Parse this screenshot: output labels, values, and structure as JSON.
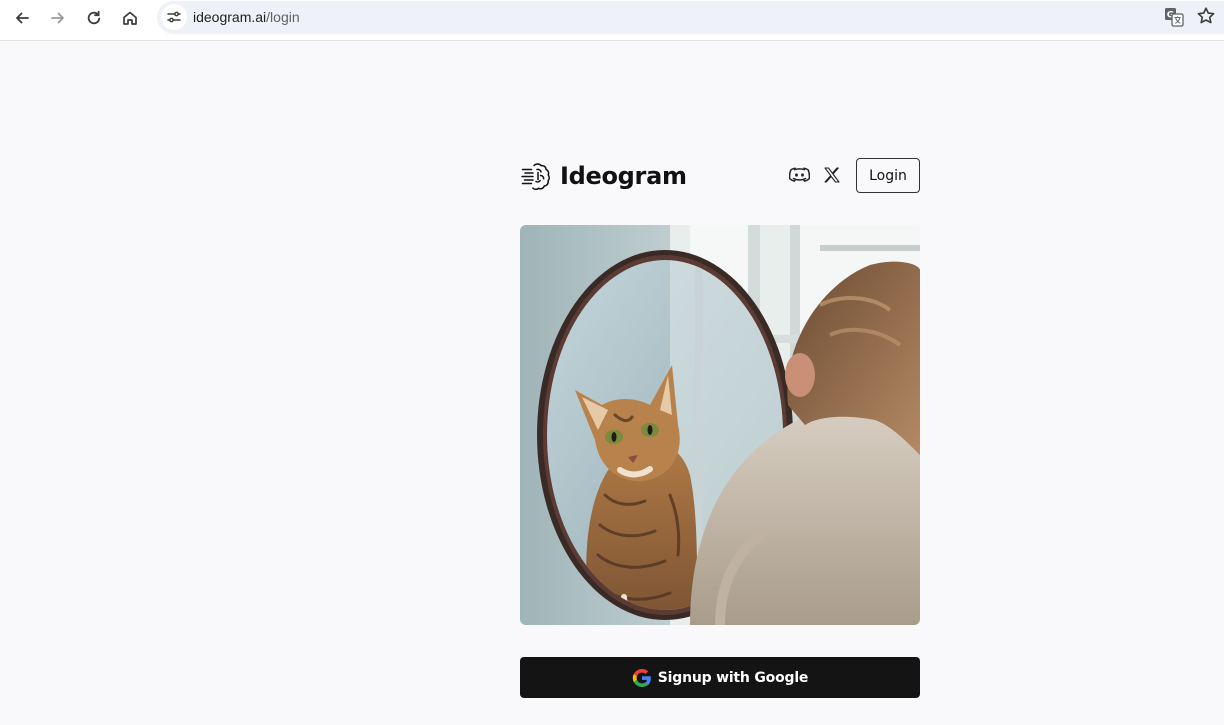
{
  "browser": {
    "url_host": "ideogram.ai",
    "url_path": "/login",
    "icons": [
      "back-icon",
      "forward-icon",
      "reload-icon",
      "home-icon",
      "site-info-icon",
      "translate-icon",
      "bookmark-star-icon"
    ]
  },
  "header": {
    "brand_name": "Ideogram",
    "logo_icon": "ideogram-brain-logo",
    "social_icons": [
      "discord-icon",
      "x-icon"
    ],
    "login_label": "Login"
  },
  "hero": {
    "image_subject": "hero-image"
  },
  "signup": {
    "label": "Signup with Google",
    "icon": "google-icon"
  },
  "colors": {
    "page_background": "#f9f8fb",
    "button_dark": "#141414",
    "address_bar": "#eef1f8"
  }
}
